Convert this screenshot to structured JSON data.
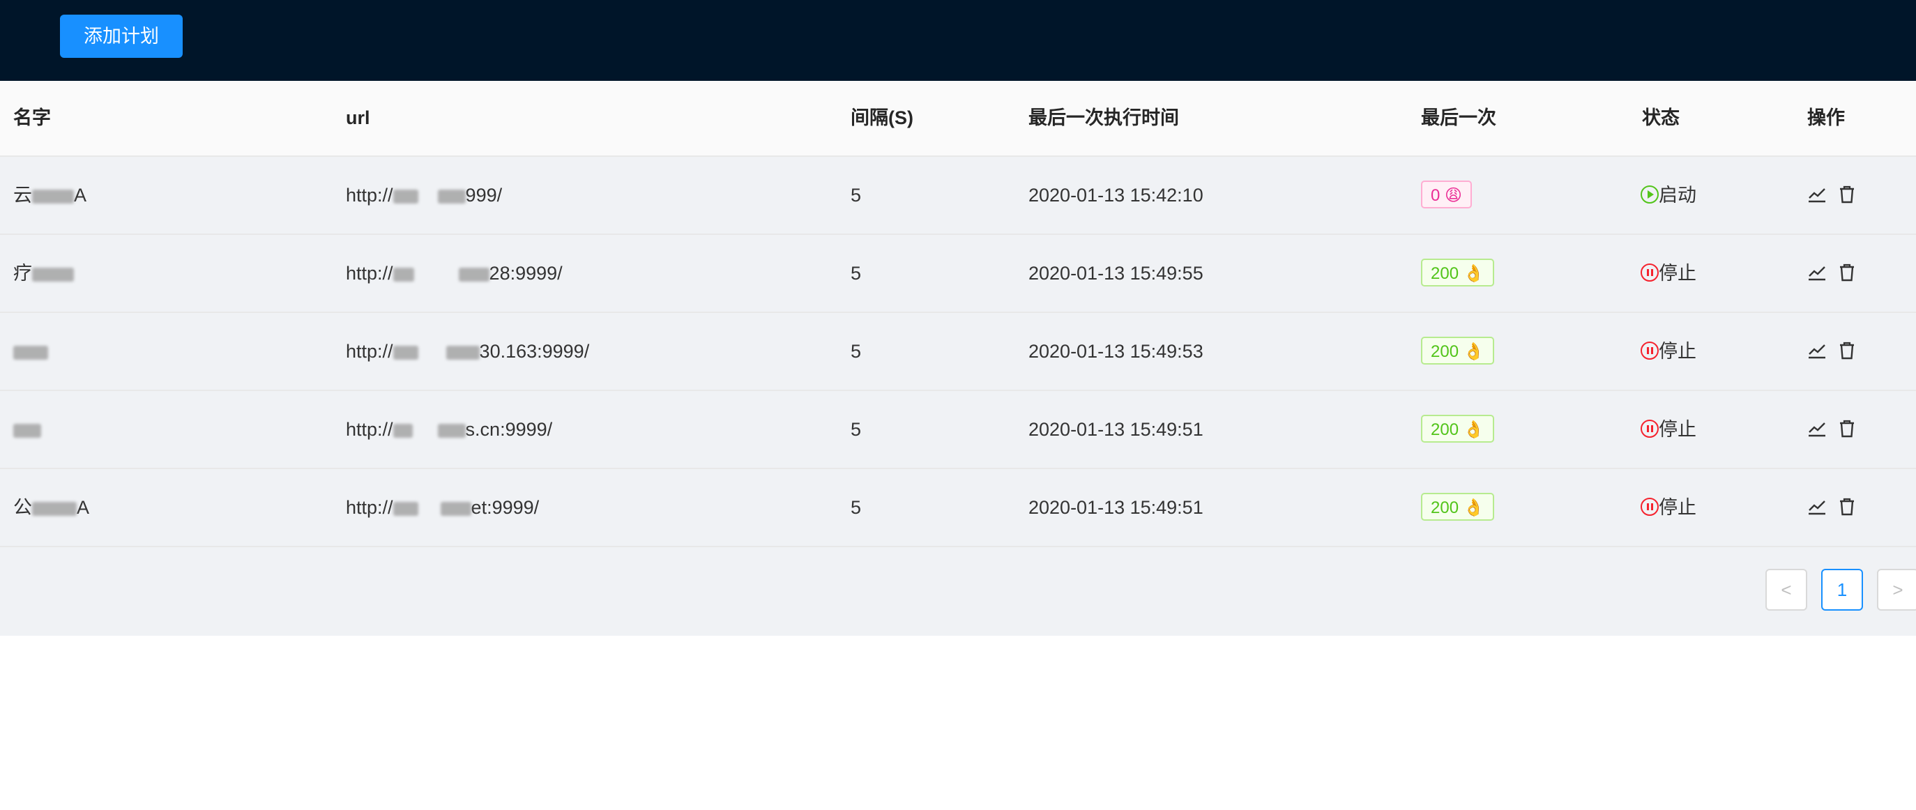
{
  "header": {
    "add_button": "添加计划"
  },
  "table": {
    "columns": [
      "名字",
      "url",
      "间隔(S)",
      "最后一次执行时间",
      "最后一次",
      "状态",
      "操作"
    ],
    "rows": [
      {
        "name_visible": "云",
        "name_tail": "A",
        "url_prefix": "http://",
        "url_suffix": "999/",
        "interval": "5",
        "last_time": "2020-01-13 15:42:10",
        "last_code": "0 😩",
        "status": "启动",
        "status_kind": "running"
      },
      {
        "name_visible": "疗",
        "name_tail": "",
        "url_prefix": "http://",
        "url_suffix": "28:9999/",
        "interval": "5",
        "last_time": "2020-01-13 15:49:55",
        "last_code": "200 👌",
        "status": "停止",
        "status_kind": "stopped"
      },
      {
        "name_visible": "",
        "name_tail": "",
        "url_prefix": "http://",
        "url_suffix": "30.163:9999/",
        "interval": "5",
        "last_time": "2020-01-13 15:49:53",
        "last_code": "200 👌",
        "status": "停止",
        "status_kind": "stopped"
      },
      {
        "name_visible": "",
        "name_tail": "",
        "url_prefix": "http://",
        "url_suffix": "s.cn:9999/",
        "interval": "5",
        "last_time": "2020-01-13 15:49:51",
        "last_code": "200 👌",
        "status": "停止",
        "status_kind": "stopped"
      },
      {
        "name_visible": "公",
        "name_tail": "A",
        "url_prefix": "http://",
        "url_suffix": "et:9999/",
        "interval": "5",
        "last_time": "2020-01-13 15:49:51",
        "last_code": "200 👌",
        "status": "停止",
        "status_kind": "stopped"
      }
    ]
  },
  "ops_icons": [
    "line-chart-icon",
    "delete-icon"
  ],
  "pagination": {
    "prev": "<",
    "current": "1",
    "next": ">"
  },
  "colors": {
    "header_bg": "#001529",
    "primary": "#1890ff",
    "ok": "#52c41a",
    "err": "#eb2f96",
    "stop": "#f5222d"
  }
}
